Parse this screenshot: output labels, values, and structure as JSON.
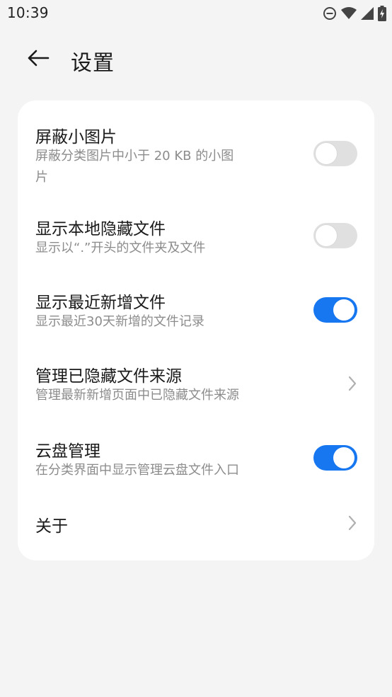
{
  "status_bar": {
    "time": "10:39",
    "icons": [
      "do-not-disturb-icon",
      "wifi-icon",
      "signal-icon",
      "battery-charging-icon"
    ]
  },
  "header": {
    "title": "设置",
    "back_icon": "arrow-left-icon"
  },
  "settings": [
    {
      "title": "屏蔽小图片",
      "subtitle_line1": "屏蔽分类图片中小于 20 KB 的小图",
      "subtitle_line2": "片",
      "control": "toggle",
      "enabled": false
    },
    {
      "title": "显示本地隐藏文件",
      "subtitle": "显示以“.”开头的文件夹及文件",
      "control": "toggle",
      "enabled": false
    },
    {
      "title": "显示最近新增文件",
      "subtitle": "显示最近30天新增的文件记录",
      "control": "toggle",
      "enabled": true
    },
    {
      "title": "管理已隐藏文件来源",
      "subtitle": "管理最新新增页面中已隐藏文件来源",
      "control": "chevron"
    },
    {
      "title": "云盘管理",
      "subtitle": "在分类界面中显示管理云盘文件入口",
      "control": "toggle",
      "enabled": true
    },
    {
      "title": "关于",
      "control": "chevron"
    }
  ],
  "colors": {
    "background": "#f4f4f4",
    "card": "#ffffff",
    "accent": "#1677f0",
    "toggle_off": "#e0e0e0",
    "subtitle": "#8c8c8c"
  }
}
